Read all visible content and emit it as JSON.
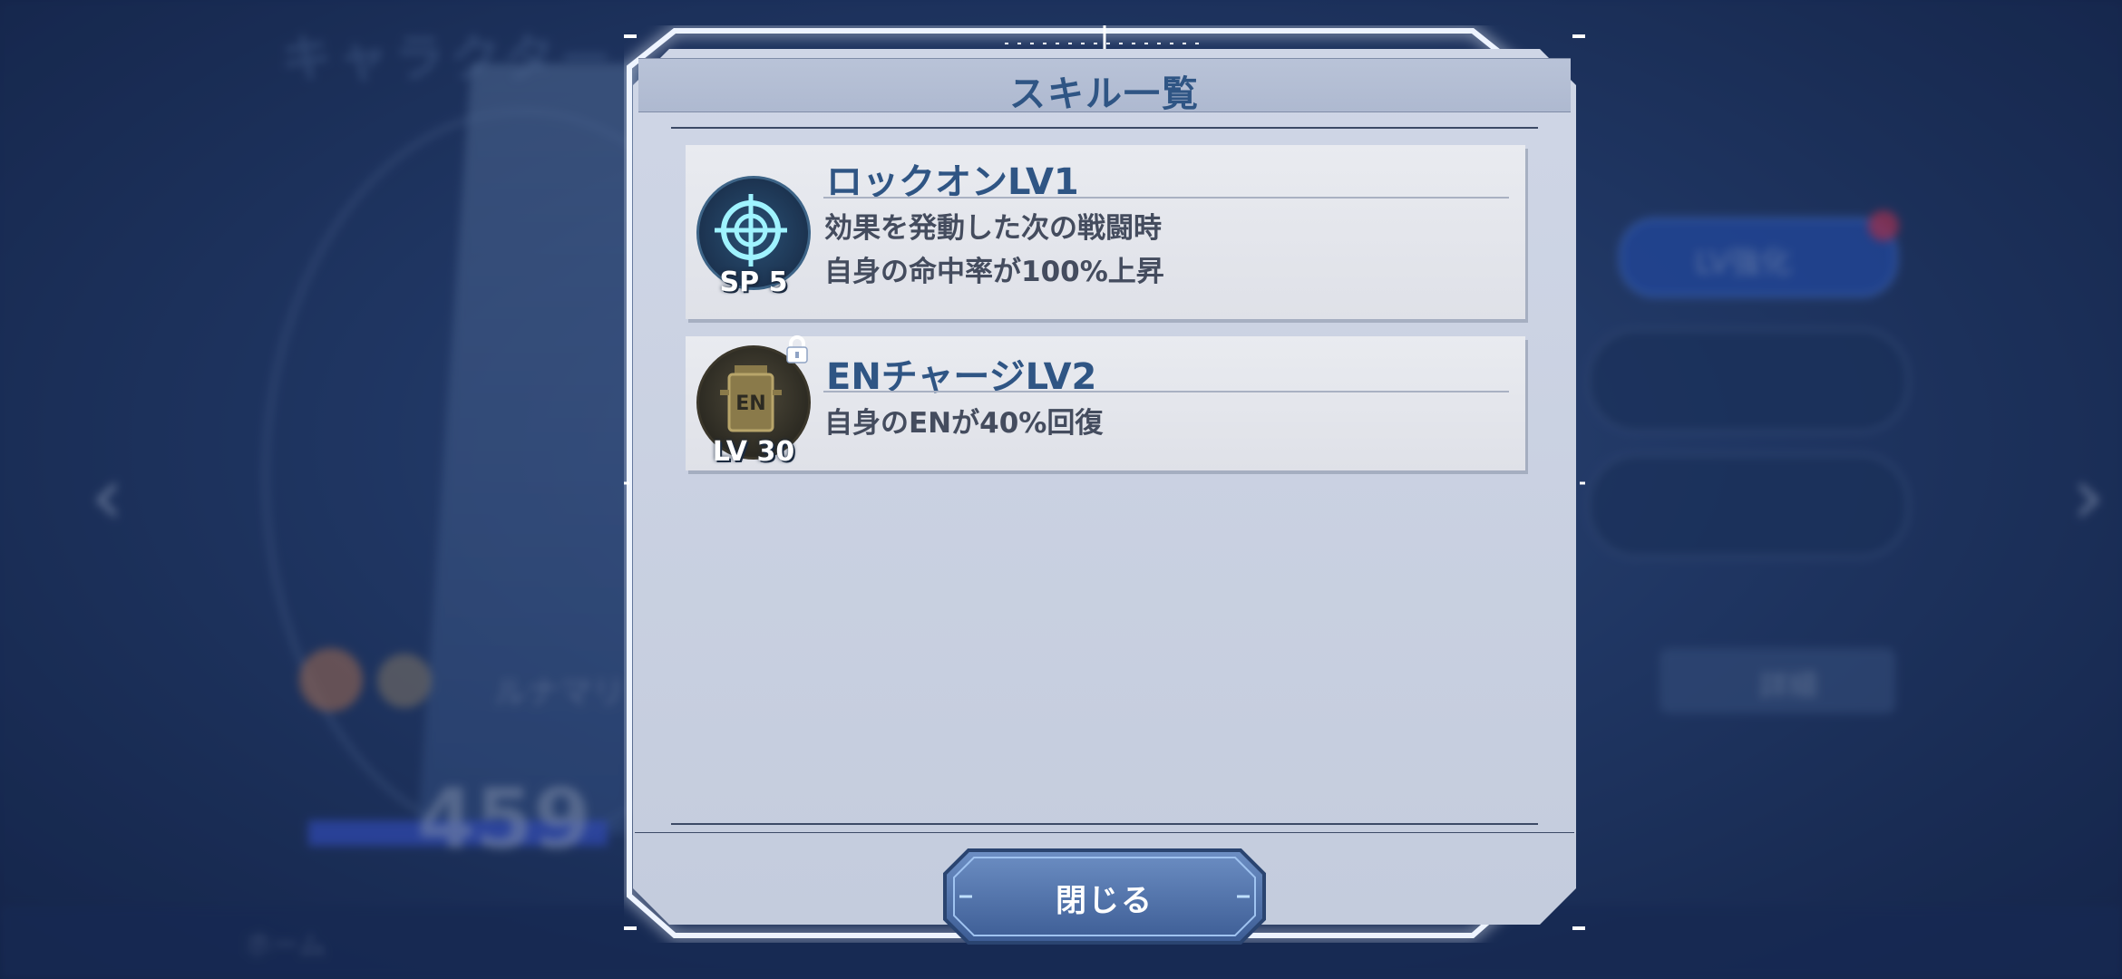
{
  "background": {
    "screen_title": "キャラクター",
    "character_name": "ルナマリ",
    "stat_value": "459",
    "level_button": "LV強化",
    "detail_button": "詳細",
    "nav_home": "ホーム"
  },
  "modal": {
    "title": "スキル一覧",
    "close_label": "閉じる"
  },
  "skills": [
    {
      "name": "ロックオンLV1",
      "icon": "crosshair-icon",
      "caption": "SP 5",
      "locked": false,
      "description": [
        "効果を発動した次の戦闘時",
        "自身の命中率が100%上昇"
      ]
    },
    {
      "name": "ENチャージLV2",
      "icon": "en-battery-icon",
      "icon_text": "EN",
      "caption": "LV 30",
      "locked": true,
      "description": [
        "自身のENが40%回復"
      ]
    }
  ],
  "colors": {
    "title": "#2f5584",
    "panel": "#c8d0e0",
    "card": "#e6e8ee",
    "frame_glow": "#e8f0ff"
  }
}
